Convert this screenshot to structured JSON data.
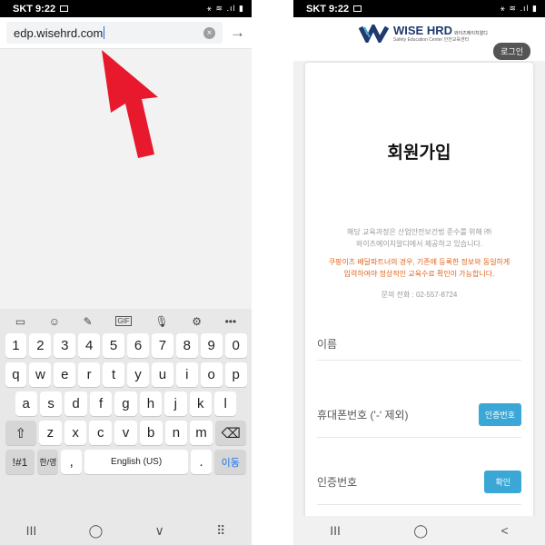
{
  "status": {
    "carrier_time": "SKT 9:22",
    "icons": "⚹ ≋ .ıl ▮"
  },
  "left": {
    "url": "edp.wisehrd.com",
    "toolbar": [
      "▭",
      "☺",
      "✎",
      "GIF",
      "🎙",
      "⚙",
      "•••"
    ],
    "rows": [
      [
        "1",
        "2",
        "3",
        "4",
        "5",
        "6",
        "7",
        "8",
        "9",
        "0"
      ],
      [
        "q",
        "w",
        "e",
        "r",
        "t",
        "y",
        "u",
        "i",
        "o",
        "p"
      ],
      [
        "a",
        "s",
        "d",
        "f",
        "g",
        "h",
        "j",
        "k",
        "l"
      ],
      [
        "z",
        "x",
        "c",
        "v",
        "b",
        "n",
        "m"
      ]
    ],
    "shift": "⇧",
    "backspace": "⌫",
    "sym_key": "!#1",
    "lang_key": "한/영",
    "comma": ",",
    "space": "English (US)",
    "period": ".",
    "enter": "이동",
    "nav": [
      "III",
      "◯",
      "∨",
      "⠿"
    ]
  },
  "right": {
    "brand": "WISE HRD",
    "brand_sub": "와이즈에이치알디",
    "brand_tag": "Safety Education Center 안전교육센터",
    "login": "로그인",
    "title": "회원가입",
    "note_line1": "해당 교육과정은 산업안전보건법 준수를 위해 ㈜",
    "note_line2": "와이즈에이치알디에서 제공하고 있습니다.",
    "warn_line1": "쿠팡이츠 배달파트너의 경우, 기존에 등록한 정보와 동일하게",
    "warn_line2": "입력하여야 정상적인 교육수료 확인이 가능합니다.",
    "contact": "문의 전화 : 02-557-8724",
    "name_label": "이름",
    "phone_label": "휴대폰번호 ('-' 제외)",
    "verify_btn": "인증번호",
    "code_label": "인증번호",
    "confirm_btn": "확인",
    "nav": [
      "III",
      "◯",
      "<"
    ]
  }
}
